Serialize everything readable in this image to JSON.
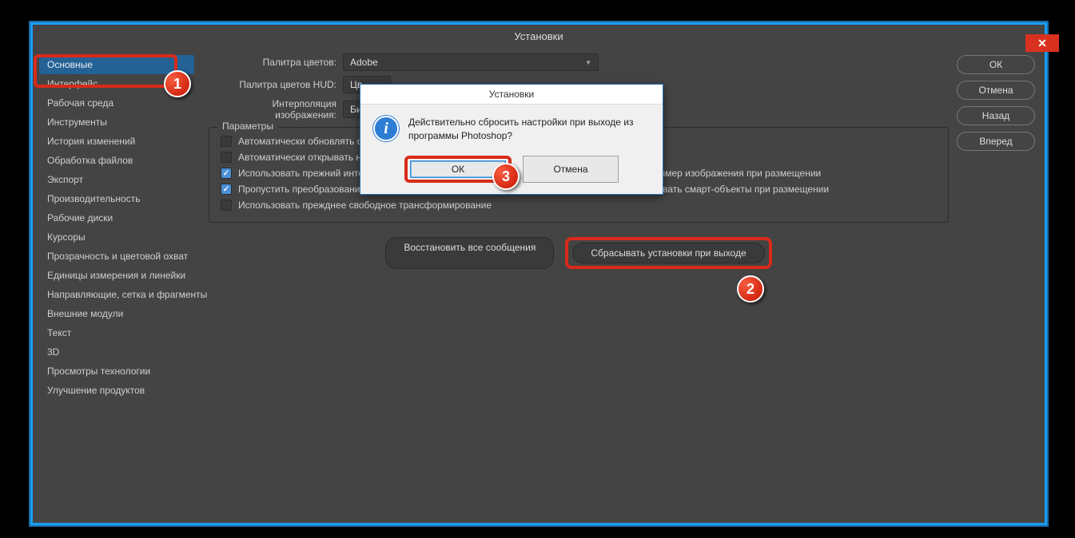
{
  "window": {
    "title": "Установки"
  },
  "close_glyph": "✕",
  "sidebar": {
    "items": [
      "Основные",
      "Интерфейс",
      "Рабочая среда",
      "Инструменты",
      "История изменений",
      "Обработка файлов",
      "Экспорт",
      "Производительность",
      "Рабочие диски",
      "Курсоры",
      "Прозрачность и цветовой охват",
      "Единицы измерения и линейки",
      "Направляющие, сетка и фрагменты",
      "Внешние модули",
      "Текст",
      "3D",
      "Просмотры технологии",
      "Улучшение продуктов"
    ]
  },
  "form": {
    "palette_label": "Палитра цветов:",
    "palette_value": "Adobe",
    "hud_label": "Палитра цветов HUD:",
    "hud_value": "Цв",
    "interp_label": "Интерполяция изображения:",
    "interp_value": "Би"
  },
  "fieldset": {
    "legend": "Параметры",
    "checks": [
      {
        "label": "Автоматически обновлять откр",
        "checked": false,
        "col": 1
      },
      {
        "label": "Автоматически открывать нач",
        "checked": false,
        "col": 1
      },
      {
        "label": "Использовать прежний интерфейс \"Новый документ\"",
        "checked": true,
        "col": 1
      },
      {
        "label": "Изменить размер изображения при размещении",
        "checked": true,
        "col": 2
      },
      {
        "label": "Пропустить преобразование при размещении",
        "checked": true,
        "col": 1
      },
      {
        "label": "Всегда создавать смарт-объекты при размещении",
        "checked": true,
        "col": 2
      },
      {
        "label": "Использовать прежднее свободное трансформирование",
        "checked": false,
        "col": 1
      }
    ]
  },
  "buttons": {
    "restore_msgs": "Восстановить все сообщения",
    "reset_on_exit": "Сбрасывать установки при выходе"
  },
  "right": {
    "ok": "ОК",
    "cancel": "Отмена",
    "back": "Назад",
    "forward": "Вперед"
  },
  "dialog": {
    "title": "Установки",
    "text": "Действительно сбросить настройки при выходе из программы Photoshop?",
    "ok": "ОК",
    "cancel": "Отмена"
  },
  "badges": {
    "b1": "1",
    "b2": "2",
    "b3": "3"
  }
}
